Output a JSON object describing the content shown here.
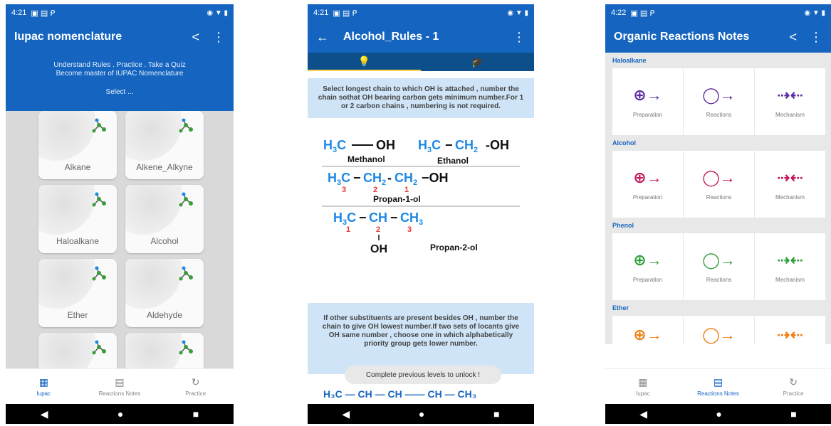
{
  "phone1": {
    "status_time": "4:21",
    "title": "Iupac nomenclature",
    "hero_line1": "Understand Rules . Practice . Take a Quiz",
    "hero_line2": "Become master of IUPAC Nomenclature",
    "select_label": "Select ...",
    "cards": [
      "Alkane",
      "Alkene_Alkyne",
      "Haloalkane",
      "Alcohol",
      "Ether",
      "Aldehyde",
      "",
      ""
    ],
    "nav": [
      "Iupac",
      "Reactions Notes",
      "Practice"
    ]
  },
  "phone2": {
    "status_time": "4:21",
    "title": "Alcohol_Rules - 1",
    "rule1": "Select longest chain to which OH is attached , number the chain sothat OH bearing carbon gets minimum number.For 1 or 2 carbon chains , numbering is not required.",
    "rule2": "If other substituents are present besides OH , number the chain to give OH lowest number.If two sets of locants give OH same number , choose one in which alphabetically priority group gets lower number.",
    "names": {
      "methanol": "Methanol",
      "ethanol": "Ethanol",
      "propan1": "Propan-1-ol",
      "propan2": "Propan-2-ol"
    },
    "toast": "Complete previous levels to unlock !"
  },
  "phone3": {
    "status_time": "4:22",
    "title": "Organic Reactions Notes",
    "sections": [
      {
        "name": "Haloalkane",
        "color": "#5b2ca0"
      },
      {
        "name": "Alcohol",
        "color": "#c2185b"
      },
      {
        "name": "Phenol",
        "color": "#2e9e3a"
      },
      {
        "name": "Ether",
        "color": "#ef7d10"
      }
    ],
    "tiles": [
      "Preparation",
      "Reactions",
      "Mechanism"
    ],
    "nav": [
      "Iupac",
      "Reactions Notes",
      "Practice"
    ]
  }
}
